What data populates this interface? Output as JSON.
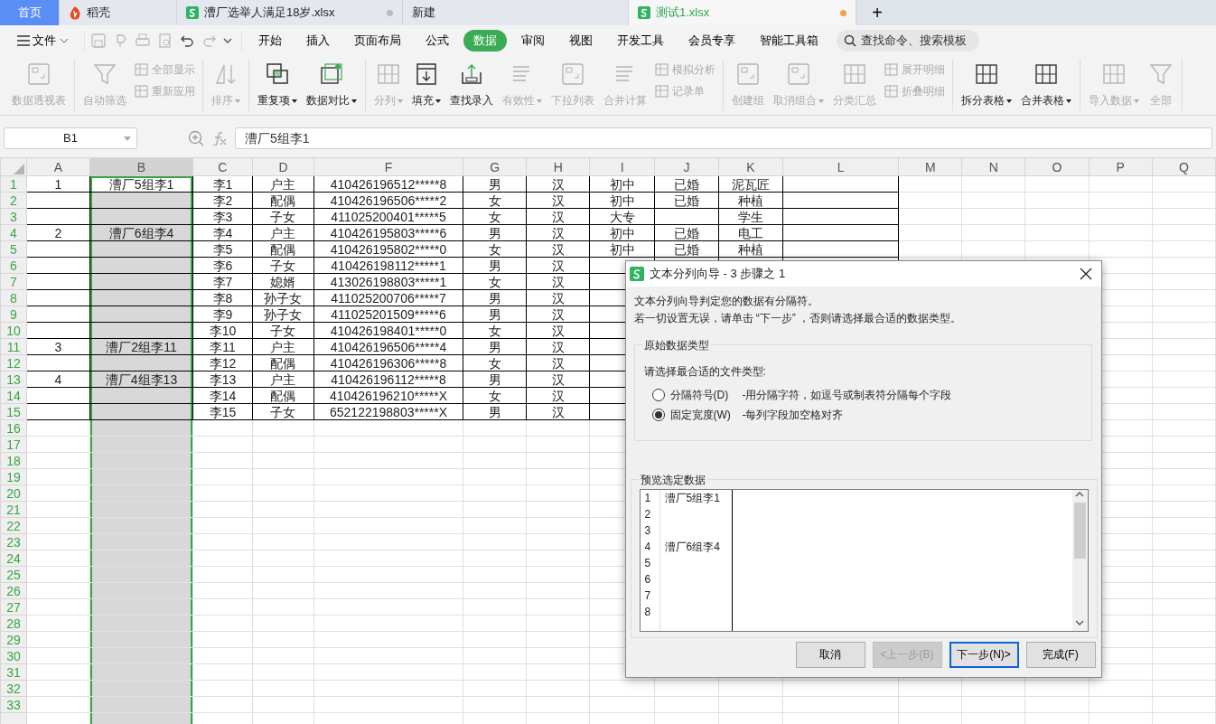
{
  "window_tabs": [
    {
      "label": "首页",
      "kind": "home",
      "selected": false,
      "modified": false
    },
    {
      "label": "稻壳",
      "kind": "app",
      "selected": false,
      "modified": false
    },
    {
      "label": "漕厂选举人满足18岁.xlsx",
      "kind": "doc",
      "selected": false,
      "modified": true
    },
    {
      "label": "新建",
      "kind": "plain",
      "selected": false,
      "modified": false
    },
    {
      "label": "测试1.xlsx",
      "kind": "doc",
      "selected": true,
      "modified": true
    }
  ],
  "new_tab": "+",
  "file_menu": "文件",
  "ribbon_tabs": [
    {
      "label": "开始",
      "selected": false
    },
    {
      "label": "插入",
      "selected": false
    },
    {
      "label": "页面布局",
      "selected": false
    },
    {
      "label": "公式",
      "selected": false
    },
    {
      "label": "数据",
      "selected": true
    },
    {
      "label": "审阅",
      "selected": false
    },
    {
      "label": "视图",
      "selected": false
    },
    {
      "label": "开发工具",
      "selected": false
    },
    {
      "label": "会员专享",
      "selected": false
    },
    {
      "label": "智能工具箱",
      "selected": false
    }
  ],
  "search": {
    "placeholder": "查找命令、搜索模板"
  },
  "toolbar_groups": [
    {
      "items": [
        {
          "kind": "large",
          "label": "数据透视表",
          "disabled": true,
          "dropdown": false
        }
      ]
    },
    {
      "items": [
        {
          "kind": "large",
          "label": "自动筛选",
          "disabled": true,
          "dropdown": false
        },
        {
          "kind": "stack",
          "items": [
            {
              "label": "全部显示",
              "disabled": true
            },
            {
              "label": "重新应用",
              "disabled": true
            }
          ]
        }
      ]
    },
    {
      "items": [
        {
          "kind": "large",
          "label": "排序",
          "disabled": true,
          "dropdown": true
        }
      ]
    },
    {
      "items": [
        {
          "kind": "large",
          "label": "重复项",
          "disabled": false,
          "dropdown": true
        },
        {
          "kind": "large",
          "label": "数据对比",
          "disabled": false,
          "dropdown": true
        }
      ]
    },
    {
      "items": [
        {
          "kind": "large",
          "label": "分列",
          "disabled": true,
          "dropdown": true
        },
        {
          "kind": "large",
          "label": "填充",
          "disabled": false,
          "dropdown": true
        },
        {
          "kind": "large",
          "label": "查找录入",
          "disabled": false,
          "dropdown": false
        },
        {
          "kind": "large",
          "label": "有效性",
          "disabled": true,
          "dropdown": true
        },
        {
          "kind": "large",
          "label": "下拉列表",
          "disabled": true,
          "dropdown": false
        },
        {
          "kind": "large",
          "label": "合并计算",
          "disabled": true,
          "dropdown": false
        },
        {
          "kind": "stack",
          "items": [
            {
              "label": "模拟分析",
              "disabled": true
            },
            {
              "label": "记录单",
              "disabled": true
            }
          ]
        }
      ]
    },
    {
      "items": [
        {
          "kind": "large",
          "label": "创建组",
          "disabled": true,
          "dropdown": false
        },
        {
          "kind": "large",
          "label": "取消组合",
          "disabled": true,
          "dropdown": true
        },
        {
          "kind": "large",
          "label": "分类汇总",
          "disabled": true,
          "dropdown": false
        },
        {
          "kind": "stack",
          "items": [
            {
              "label": "展开明细",
              "disabled": true
            },
            {
              "label": "折叠明细",
              "disabled": true
            }
          ]
        }
      ]
    },
    {
      "items": [
        {
          "kind": "large",
          "label": "拆分表格",
          "disabled": false,
          "dropdown": true
        },
        {
          "kind": "large",
          "label": "合并表格",
          "disabled": false,
          "dropdown": true
        }
      ]
    },
    {
      "items": [
        {
          "kind": "large",
          "label": "导入数据",
          "disabled": true,
          "dropdown": true
        },
        {
          "kind": "large",
          "label": "全部",
          "disabled": true,
          "dropdown": false
        }
      ]
    }
  ],
  "formula_bar": {
    "name_box": "B1",
    "formula": "漕厂5组李1"
  },
  "sheet": {
    "columns": [
      {
        "label": "A",
        "selected": false
      },
      {
        "label": "B",
        "selected": true
      },
      {
        "label": "C",
        "selected": false
      },
      {
        "label": "D",
        "selected": false
      },
      {
        "label": "F",
        "selected": false
      },
      {
        "label": "G",
        "selected": false
      },
      {
        "label": "H",
        "selected": false
      },
      {
        "label": "I",
        "selected": false
      },
      {
        "label": "J",
        "selected": false
      },
      {
        "label": "K",
        "selected": false
      },
      {
        "label": "L",
        "selected": false
      },
      {
        "label": "M",
        "selected": false
      },
      {
        "label": "N",
        "selected": false
      },
      {
        "label": "O",
        "selected": false
      },
      {
        "label": "P",
        "selected": false
      },
      {
        "label": "Q",
        "selected": false
      }
    ],
    "row_headers": [
      "1",
      "2",
      "3",
      "4",
      "5",
      "6",
      "7",
      "8",
      "9",
      "10",
      "11",
      "12",
      "13",
      "14",
      "15",
      "16",
      "17",
      "18",
      "19",
      "20",
      "21",
      "22",
      "23",
      "24",
      "25",
      "26",
      "27",
      "28",
      "29",
      "30",
      "31",
      "32",
      "33"
    ],
    "rows": [
      {
        "cells": {
          "A": "1",
          "B": "漕厂5组李1",
          "C": "李1",
          "D": "户主",
          "F": "410426196512*****8",
          "G": "男",
          "H": "汉",
          "I": "初中",
          "J": "已婚",
          "K": "泥瓦匠"
        }
      },
      {
        "cells": {
          "C": "李2",
          "D": "配偶",
          "F": "410426196506*****2",
          "G": "女",
          "H": "汉",
          "I": "初中",
          "J": "已婚",
          "K": "种植"
        }
      },
      {
        "cells": {
          "C": "李3",
          "D": "子女",
          "F": "411025200401*****5",
          "G": "女",
          "H": "汉",
          "I": "大专",
          "K": "学生"
        }
      },
      {
        "cells": {
          "A": "2",
          "B": "漕厂6组李4",
          "C": "李4",
          "D": "户主",
          "F": "410426195803*****6",
          "G": "男",
          "H": "汉",
          "I": "初中",
          "J": "已婚",
          "K": "电工"
        }
      },
      {
        "cells": {
          "C": "李5",
          "D": "配偶",
          "F": "410426195802*****0",
          "G": "女",
          "H": "汉",
          "I": "初中",
          "J": "已婚",
          "K": "种植"
        }
      },
      {
        "cells": {
          "C": "李6",
          "D": "子女",
          "F": "410426198112*****1",
          "G": "男",
          "H": "汉"
        }
      },
      {
        "cells": {
          "C": "李7",
          "D": "媳婿",
          "F": "413026198803*****1",
          "G": "女",
          "H": "汉"
        }
      },
      {
        "cells": {
          "C": "李8",
          "D": "孙子女",
          "F": "411025200706*****7",
          "G": "男",
          "H": "汉"
        }
      },
      {
        "cells": {
          "C": "李9",
          "D": "孙子女",
          "F": "411025201509*****6",
          "G": "男",
          "H": "汉"
        }
      },
      {
        "cells": {
          "C": "李10",
          "D": "子女",
          "F": "410426198401*****0",
          "G": "女",
          "H": "汉"
        }
      },
      {
        "cells": {
          "A": "3",
          "B": "漕厂2组李11",
          "C": "李11",
          "D": "户主",
          "F": "410426196506*****4",
          "G": "男",
          "H": "汉"
        }
      },
      {
        "cells": {
          "C": "李12",
          "D": "配偶",
          "F": "410426196306*****8",
          "G": "女",
          "H": "汉"
        }
      },
      {
        "cells": {
          "A": "4",
          "B": "漕厂4组李13",
          "C": "李13",
          "D": "户主",
          "F": "410426196112*****8",
          "G": "男",
          "H": "汉"
        }
      },
      {
        "cells": {
          "C": "李14",
          "D": "配偶",
          "F": "410426196210*****X",
          "G": "女",
          "H": "汉"
        }
      },
      {
        "cells": {
          "C": "李15",
          "D": "子女",
          "F": "652122198803*****X",
          "G": "男",
          "H": "汉"
        }
      }
    ]
  },
  "dialog": {
    "title": "文本分列向导 - 3 步骤之 1",
    "intro": [
      "文本分列向导判定您的数据有分隔符。",
      "若一切设置无误，请单击 “下一步” ，否则请选择最合适的数据类型。"
    ],
    "type_group": {
      "legend": "原始数据类型",
      "prompt": "请选择最合适的文件类型:",
      "options": [
        {
          "label": "分隔符号(D)",
          "description": "-用分隔字符，如逗号或制表符分隔每个字段",
          "selected": false
        },
        {
          "label": "固定宽度(W)",
          "description": "-每列字段加空格对齐",
          "selected": true
        }
      ]
    },
    "preview": {
      "legend": "预览选定数据",
      "lines": [
        {
          "number": "1",
          "text": "漕厂5组李1"
        },
        {
          "number": "2"
        },
        {
          "number": "3"
        },
        {
          "number": "4",
          "text": "漕厂6组李4"
        },
        {
          "number": "5"
        },
        {
          "number": "6"
        },
        {
          "number": "7"
        },
        {
          "number": "8"
        }
      ]
    },
    "buttons": [
      {
        "label": "取消",
        "disabled": false,
        "default": false
      },
      {
        "label": "<上一步(B)",
        "disabled": true,
        "default": false
      },
      {
        "label": "下一步(N)>",
        "disabled": false,
        "default": true
      },
      {
        "label": "完成(F)",
        "disabled": false,
        "default": false
      }
    ]
  }
}
